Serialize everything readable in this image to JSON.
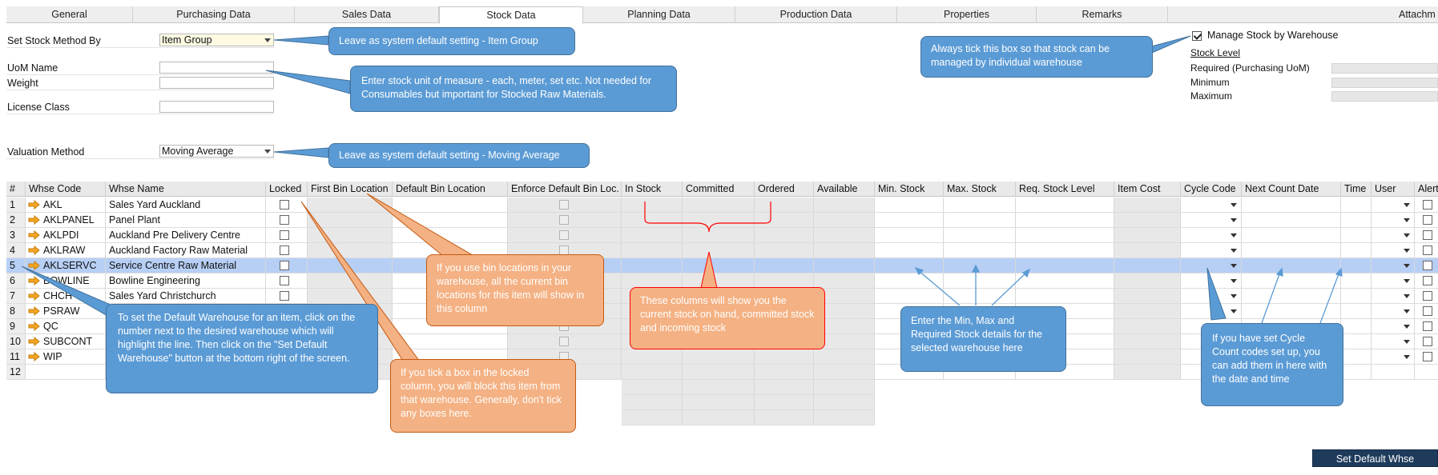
{
  "tabs": [
    {
      "label": "General"
    },
    {
      "label": "Purchasing Data"
    },
    {
      "label": "Sales Data"
    },
    {
      "label": "Stock Data"
    },
    {
      "label": "Planning Data"
    },
    {
      "label": "Production Data"
    },
    {
      "label": "Properties"
    },
    {
      "label": "Remarks"
    },
    {
      "label": "Attachm"
    }
  ],
  "form": {
    "stock_method_label": "Set Stock Method By",
    "stock_method_value": "Item Group",
    "uom_label": "UoM Name",
    "weight_label": "Weight",
    "license_label": "License Class",
    "valuation_label": "Valuation Method",
    "valuation_value": "Moving Average"
  },
  "warehouse_panel": {
    "manage_label": "Manage Stock by Warehouse",
    "manage_checked": true,
    "stock_level_title": "Stock Level",
    "required_label": "Required (Purchasing UoM)",
    "minimum_label": "Minimum",
    "maximum_label": "Maximum"
  },
  "grid": {
    "headers": [
      "#",
      "Whse Code",
      "Whse Name",
      "Locked",
      "First Bin Location",
      "Default Bin Location",
      "Enforce Default Bin Loc.",
      "In Stock",
      "Committed",
      "Ordered",
      "Available",
      "Min. Stock",
      "Max. Stock",
      "Req. Stock Level",
      "Item Cost",
      "Cycle Code",
      "Next Count Date",
      "Time",
      "User",
      "Alert"
    ],
    "rows": [
      {
        "num": "1",
        "code": "AKL",
        "name": "Sales Yard Auckland"
      },
      {
        "num": "2",
        "code": "AKLPANEL",
        "name": "Panel Plant"
      },
      {
        "num": "3",
        "code": "AKLPDI",
        "name": "Auckland Pre Delivery Centre"
      },
      {
        "num": "4",
        "code": "AKLRAW",
        "name": "Auckland Factory Raw Material"
      },
      {
        "num": "5",
        "code": "AKLSERVC",
        "name": "Service Centre Raw Material"
      },
      {
        "num": "6",
        "code": "BOWLINE",
        "name": "Bowline Engineering"
      },
      {
        "num": "7",
        "code": "CHCH",
        "name": "Sales Yard Christchurch"
      },
      {
        "num": "8",
        "code": "PSRAW",
        "name": ""
      },
      {
        "num": "9",
        "code": "QC",
        "name": ""
      },
      {
        "num": "10",
        "code": "SUBCONT",
        "name": ""
      },
      {
        "num": "11",
        "code": "WIP",
        "name": ""
      },
      {
        "num": "12",
        "code": "",
        "name": ""
      }
    ],
    "selected_row": 5
  },
  "callouts": {
    "item_group": "Leave as system default setting - Item Group",
    "uom": "Enter stock unit of measure - each, meter, set etc.  Not needed for Consumables but important for Stocked Raw Materials.",
    "moving_avg": "Leave as system default setting - Moving Average",
    "manage_whse": "Always tick this box so that stock can be managed by individual warehouse",
    "default_whse": "To set the Default Warehouse for an item, click on the number next to the desired warehouse which will highlight the line.  Then click on the \"Set Default Warehouse\" button at the bottom right of the screen.",
    "bin": "If you use bin locations in your warehouse, all the current bin locations for this item will show in this column",
    "locked": "If you tick a box in the locked column, you will block this item from that warehouse.  Generally, don't tick any boxes here.",
    "stock_cols": "These columns will show you the current stock on hand, committed stock and incoming stock",
    "minmax": "Enter the Min, Max and Required Stock details for the selected warehouse here",
    "cycle": "If you have set Cycle Count codes set up, you can add them in here with the date and time"
  },
  "buttons": {
    "set_default": "Set Default Whse"
  },
  "colors": {
    "callout_blue": "#5b9bd5",
    "callout_orange": "#f4b183",
    "selected_row": "#b7cff5",
    "button": "#1f3b5c"
  }
}
